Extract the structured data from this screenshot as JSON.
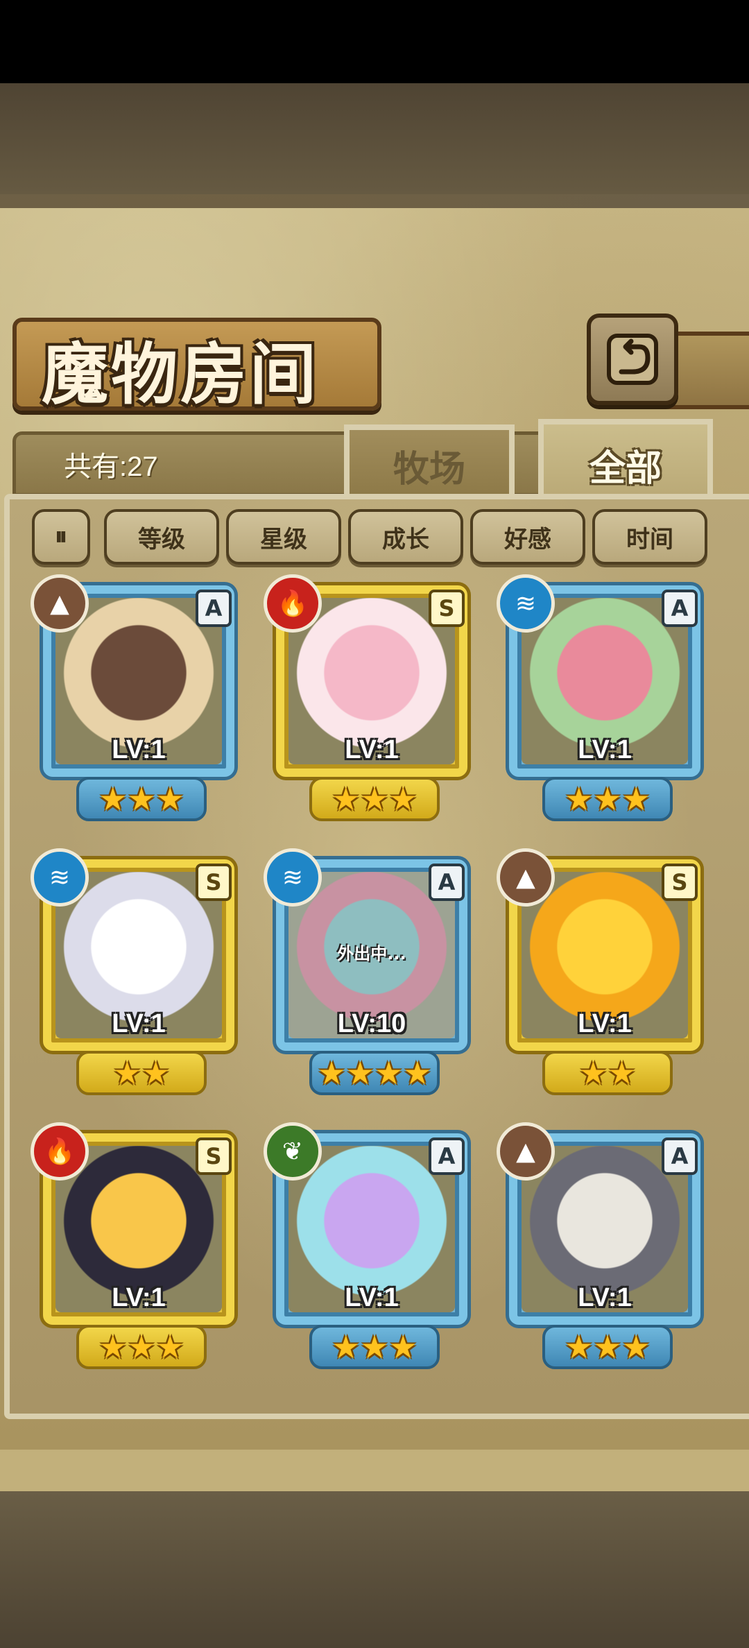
{
  "header": {
    "title": "魔物房间",
    "back_icon": "back-return-icon",
    "total_count": "共有:27"
  },
  "tabs": [
    {
      "label": "牧场",
      "active": false
    },
    {
      "label": "全部",
      "active": true
    }
  ],
  "sort": {
    "toggle_icon": "sort-order-icon",
    "options": [
      "等级",
      "星级",
      "成长",
      "好感",
      "时间"
    ]
  },
  "monsters": [
    {
      "element": "earth",
      "rank": "A",
      "level": "LV:1",
      "stars": "★★★",
      "palette": [
        "#6b4b3a",
        "#e8d2a8"
      ],
      "status": ""
    },
    {
      "element": "fire",
      "rank": "S",
      "level": "LV:1",
      "stars": "★★★",
      "palette": [
        "#f5b8c8",
        "#fbe6ea"
      ],
      "status": ""
    },
    {
      "element": "water",
      "rank": "A",
      "level": "LV:1",
      "stars": "★★★",
      "palette": [
        "#e98a9b",
        "#a7d39a"
      ],
      "status": ""
    },
    {
      "element": "water",
      "rank": "S",
      "level": "LV:1",
      "stars": "★★",
      "palette": [
        "#ffffff",
        "#dcdcea"
      ],
      "status": ""
    },
    {
      "element": "water",
      "rank": "A",
      "level": "LV:10",
      "stars": "★★★★",
      "palette": [
        "#6fb6b1",
        "#d9667a"
      ],
      "status": "外出中..."
    },
    {
      "element": "earth",
      "rank": "S",
      "level": "LV:1",
      "stars": "★★",
      "palette": [
        "#ffd23a",
        "#f5a71a"
      ],
      "status": ""
    },
    {
      "element": "fire",
      "rank": "S",
      "level": "LV:1",
      "stars": "★★★",
      "palette": [
        "#f9c64a",
        "#2d2a3a"
      ],
      "status": ""
    },
    {
      "element": "wood",
      "rank": "A",
      "level": "LV:1",
      "stars": "★★★",
      "palette": [
        "#c9a6f0",
        "#9de0ea"
      ],
      "status": ""
    },
    {
      "element": "earth",
      "rank": "A",
      "level": "LV:1",
      "stars": "★★★",
      "palette": [
        "#e9e6de",
        "#6b6b75"
      ],
      "status": ""
    }
  ],
  "element_colors": {
    "earth": "#7a5238",
    "fire": "#c8221c",
    "water": "#1f86c7",
    "wood": "#3c7a28"
  },
  "element_glyphs": {
    "earth": "▲",
    "fire": "🔥",
    "water": "≋",
    "wood": "❦"
  }
}
